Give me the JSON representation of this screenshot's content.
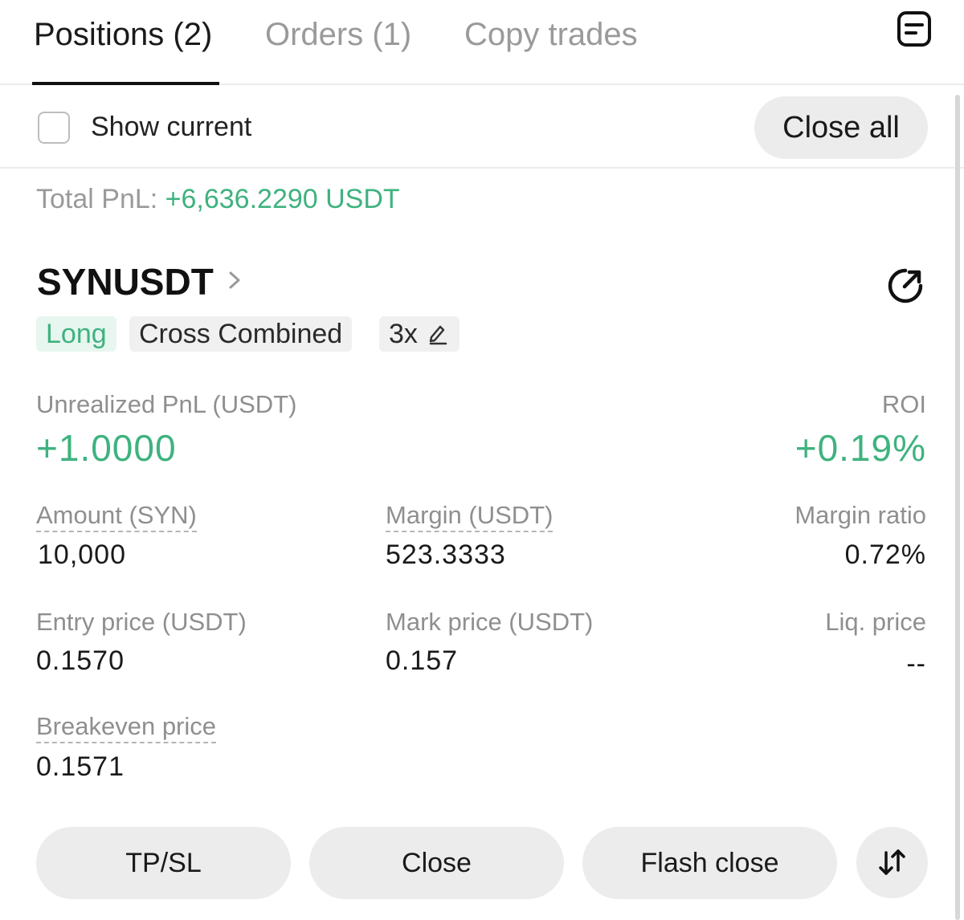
{
  "tabs": {
    "positions": "Positions (2)",
    "orders": "Orders (1)",
    "copy_trades": "Copy trades"
  },
  "filter": {
    "show_current": "Show current",
    "close_all": "Close all"
  },
  "summary": {
    "total_pnl_label": "Total PnL: ",
    "total_pnl_value": "+6,636.2290 USDT"
  },
  "position": {
    "symbol": "SYNUSDT",
    "side": "Long",
    "margin_mode": "Cross Combined",
    "leverage": "3x",
    "unrealized_pnl_label": "Unrealized PnL (USDT)",
    "unrealized_pnl_value": "+1.0000",
    "roi_label": "ROI",
    "roi_value": "+0.19%",
    "amount_label": "Amount (SYN)",
    "amount_value": "10,000",
    "margin_label": "Margin (USDT)",
    "margin_value": "523.3333",
    "margin_ratio_label": "Margin ratio",
    "margin_ratio_value": "0.72%",
    "entry_price_label": "Entry price (USDT)",
    "entry_price_value": "0.1570",
    "mark_price_label": "Mark price (USDT)",
    "mark_price_value": "0.157",
    "liq_price_label": "Liq. price",
    "liq_price_value": "--",
    "breakeven_label": "Breakeven price",
    "breakeven_value": "0.1571"
  },
  "actions": {
    "tpsl": "TP/SL",
    "close": "Close",
    "flash_close": "Flash close"
  },
  "icons": {
    "header": "document-list-icon",
    "chevron": "chevron-right-icon",
    "share": "share-icon",
    "pencil": "pencil-icon",
    "swap": "swap-vertical-icon"
  },
  "colors": {
    "positive": "#3fb27f",
    "long_tag_bg": "#e7f6ef",
    "button_bg": "#ececec"
  }
}
